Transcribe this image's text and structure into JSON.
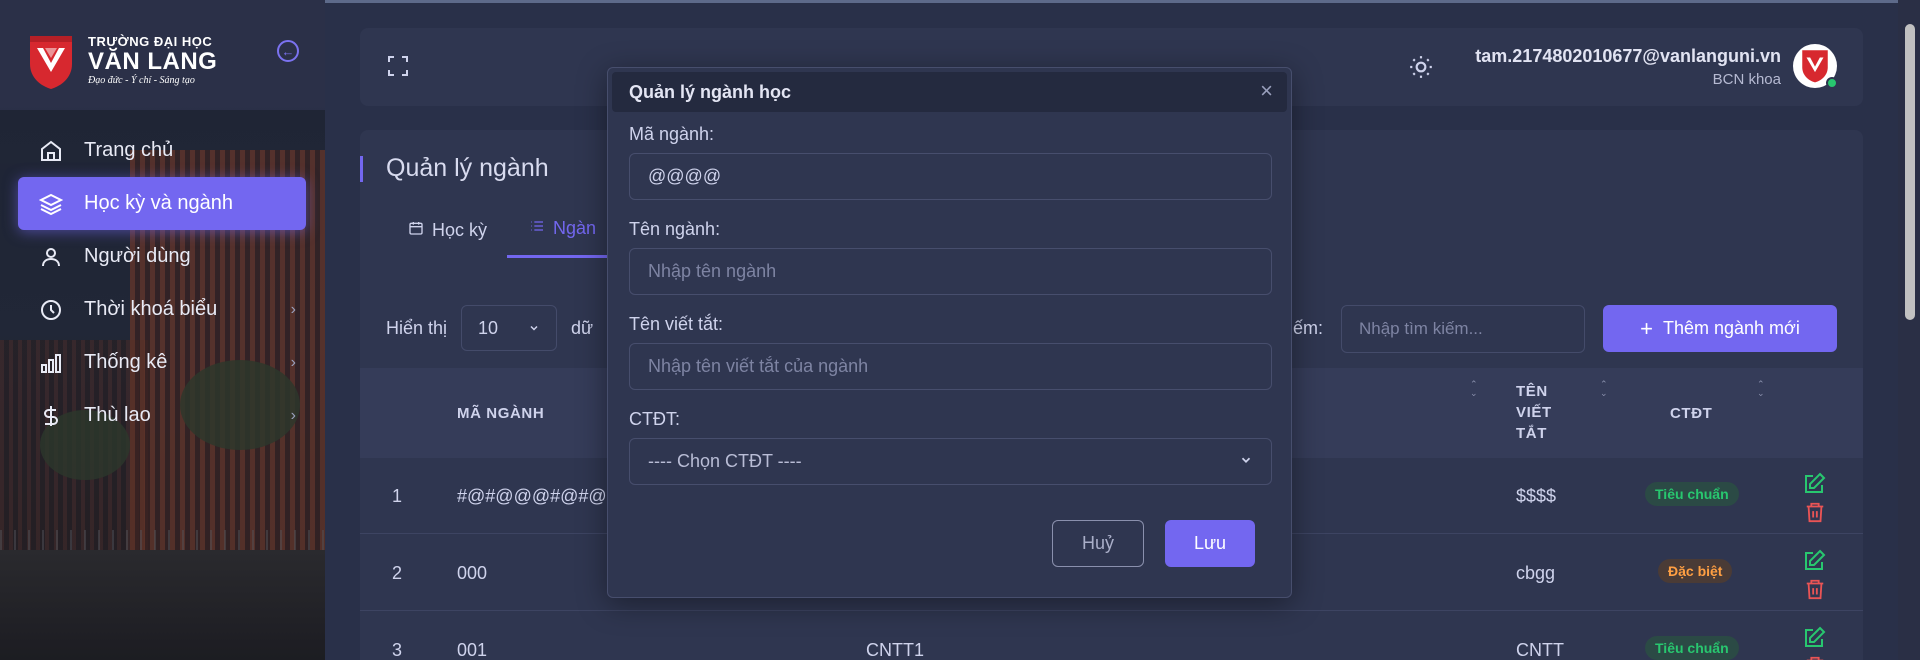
{
  "sidebar": {
    "logo": {
      "small": "TRƯỜNG ĐẠI HỌC",
      "big": "VĂN LANG",
      "motto": "Đạo đức - Ý chí - Sáng tạo"
    },
    "items": [
      {
        "label": "Trang chủ",
        "icon": "home-icon"
      },
      {
        "label": "Học kỳ và ngành",
        "icon": "layers-icon",
        "active": true
      },
      {
        "label": "Người dùng",
        "icon": "user-icon"
      },
      {
        "label": "Thời khoá biểu",
        "icon": "clock-icon",
        "has_children": true
      },
      {
        "label": "Thống kê",
        "icon": "bar-chart-icon",
        "has_children": true
      },
      {
        "label": "Thù lao",
        "icon": "dollar-icon",
        "has_children": true
      }
    ]
  },
  "header": {
    "email": "tam.2174802010677@vanlanguni.vn",
    "role": "BCN khoa"
  },
  "page": {
    "title": "Quản lý ngành",
    "tabs": [
      {
        "label": "Học kỳ"
      },
      {
        "label": "Ngàn"
      }
    ],
    "show_label": "Hiển thị",
    "page_size": "10",
    "show_suffix": "dữ",
    "search_label": "ếm:",
    "search_placeholder": "Nhập tìm kiếm...",
    "add_button": "Thêm ngành mới"
  },
  "table": {
    "headers": {
      "code": "MÃ NGÀNH",
      "abbr_1": "TÊN",
      "abbr_2": "VIẾT",
      "abbr_3": "TẮT",
      "ctdt": "CTĐT"
    },
    "rows": [
      {
        "index": "1",
        "code": "#@#@@@#@#@",
        "name": "",
        "abbr": "$$$$",
        "ctdt": "Tiêu chuẩn",
        "ctdt_type": "std"
      },
      {
        "index": "2",
        "code": "000",
        "name": "",
        "abbr": "cbgg",
        "ctdt": "Đặc biệt",
        "ctdt_type": "spec"
      },
      {
        "index": "3",
        "code": "001",
        "name": "CNTT1",
        "abbr": "CNTT",
        "ctdt": "Tiêu chuẩn",
        "ctdt_type": "std"
      }
    ]
  },
  "modal": {
    "title": "Quản lý ngành học",
    "code_label": "Mã ngành:",
    "code_value": "@@@@",
    "name_label": "Tên ngành:",
    "name_placeholder": "Nhập tên ngành",
    "abbr_label": "Tên viết tắt:",
    "abbr_placeholder": "Nhập tên viết tắt của ngành",
    "ctdt_label": "CTĐT:",
    "ctdt_selected": "---- Chọn CTĐT ----",
    "cancel": "Huỷ",
    "save": "Lưu"
  },
  "colors": {
    "accent": "#7367f0",
    "bg": "#293049",
    "card": "#2f3650",
    "success": "#28c76f",
    "warning": "#ff9f43",
    "danger": "#ea5455"
  }
}
